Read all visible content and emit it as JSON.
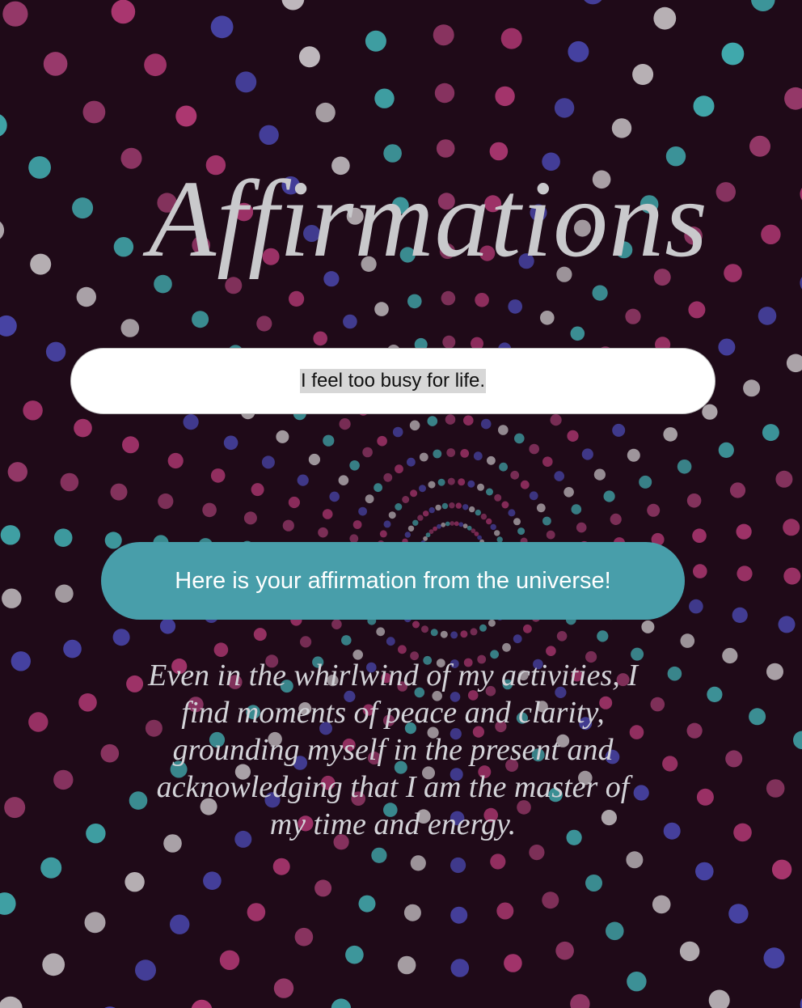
{
  "page": {
    "title": "Affirmations",
    "background_color": "#1f0a18",
    "title_color": "#c9c9cc"
  },
  "input": {
    "value": "I feel too busy for life."
  },
  "button": {
    "label": "Here is your affirmation from the universe!",
    "color": "#489eaa"
  },
  "affirmation": {
    "text": "Even in the whirlwind of my activities, I find moments of peace and clarity, grounding myself in the present and acknowledging that I am the master of my time and energy."
  },
  "background": {
    "dot_colors": [
      "#e84a96",
      "#5a5ee6",
      "#ffffff",
      "#4ee6e6",
      "#c64c8a"
    ]
  }
}
